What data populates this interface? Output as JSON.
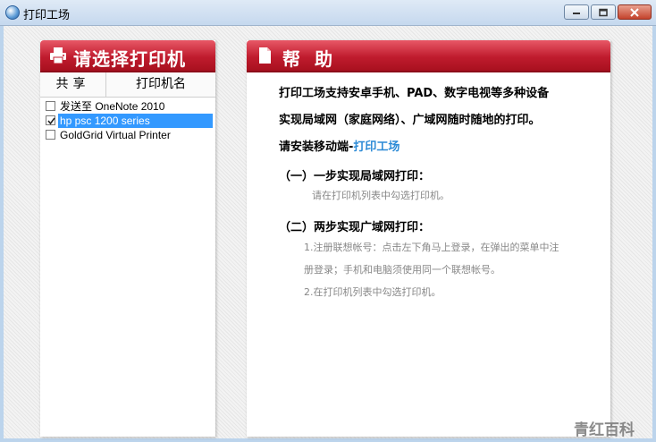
{
  "window": {
    "title": "打印工场"
  },
  "left_panel": {
    "title": "请选择打印机",
    "columns": {
      "share": "共享",
      "printer_name": "打印机名"
    },
    "printers": [
      {
        "name": "发送至 OneNote 2010",
        "checked": false,
        "selected": false
      },
      {
        "name": "hp psc 1200 series",
        "checked": true,
        "selected": true
      },
      {
        "name": "GoldGrid Virtual Printer",
        "checked": false,
        "selected": false
      }
    ]
  },
  "right_panel": {
    "title": "帮助",
    "line1": "打印工场支持安卓手机、PAD、数字电视等多种设备",
    "line2": "实现局域网（家庭网络）、广域网随时随地的打印。",
    "line3_prefix": "请安装移动端-",
    "line3_link": "打印工场",
    "step1_title": "（一）一步实现局域网打印：",
    "step1_desc": "请在打印机列表中勾选打印机。",
    "step2_title": "（二）两步实现广域网打印：",
    "step2_desc1": "1.注册联想帐号：点击左下角马上登录，在弹出的菜单中注",
    "step2_desc2": "册登录；手机和电脑须使用同一个联想帐号。",
    "step2_desc3": "2.在打印机列表中勾选打印机。"
  },
  "watermark": "青红百科",
  "colors": {
    "header_red": "#c01c2e",
    "selection_blue": "#3399ff",
    "link_blue": "#2d8bd6"
  },
  "icons": {
    "app": "app-logo-icon",
    "printer": "printer-icon",
    "help": "document-icon"
  }
}
